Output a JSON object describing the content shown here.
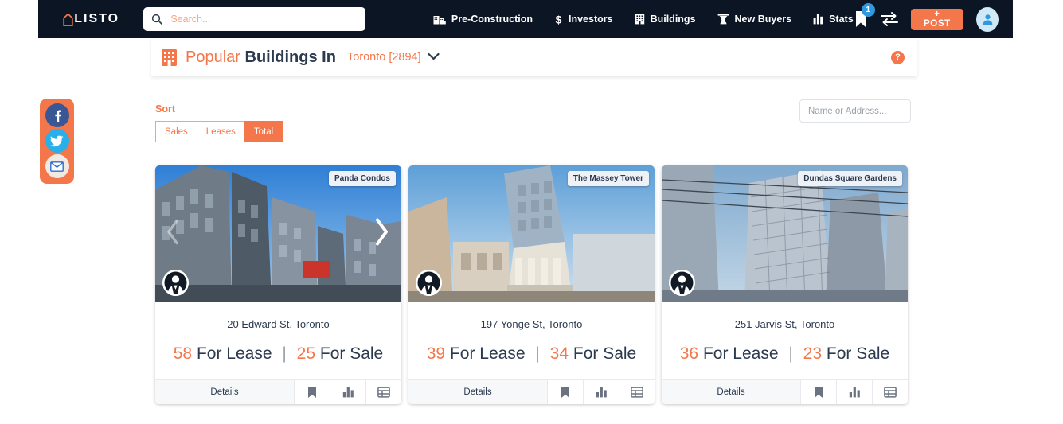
{
  "brand": {
    "name": "LISTO",
    "mark_icon": "house-outline-icon"
  },
  "search": {
    "placeholder": "Search...",
    "value": "",
    "icon": "search-icon"
  },
  "nav": {
    "items": [
      {
        "label": "Pre-Construction",
        "icon": "construction-building-icon"
      },
      {
        "label": "Investors",
        "icon": "dollar-sign-icon"
      },
      {
        "label": "Buildings",
        "icon": "building-icon"
      },
      {
        "label": "New Buyers",
        "icon": "new-buyer-icon"
      },
      {
        "label": "Stats",
        "icon": "bar-chart-icon"
      }
    ]
  },
  "header_actions": {
    "bookmark_icon": "bookmark-icon",
    "bookmark_count": "1",
    "compare_icon": "compare-arrows-icon",
    "post_label": "+ POST",
    "avatar_icon": "user-avatar-icon"
  },
  "page_title": {
    "icon": "building-icon",
    "highlight": "Popular",
    "rest": "Buildings In",
    "city": "Toronto [2894]",
    "chevron_icon": "chevron-down-icon",
    "help_label": "?"
  },
  "sort": {
    "label": "Sort",
    "options": [
      {
        "label": "Sales",
        "active": false
      },
      {
        "label": "Leases",
        "active": false
      },
      {
        "label": "Total",
        "active": true
      }
    ]
  },
  "filter_search": {
    "placeholder": "Name or Address...",
    "value": ""
  },
  "social": {
    "items": [
      {
        "name": "facebook",
        "icon": "facebook-icon"
      },
      {
        "name": "twitter",
        "icon": "twitter-icon"
      },
      {
        "name": "email",
        "icon": "envelope-icon"
      }
    ]
  },
  "cards": [
    {
      "badge": "Panda Condos",
      "address": "20 Edward St, Toronto",
      "lease_count": "58",
      "lease_label": "For Lease",
      "sale_count": "25",
      "sale_label": "For Sale",
      "separator": "|",
      "details_label": "Details",
      "agent_icon": "agent-avatar-icon",
      "next_icon": "chevron-right-icon",
      "prev_icon": "chevron-left-icon",
      "actions": [
        {
          "icon": "bookmark-icon"
        },
        {
          "icon": "bar-chart-icon"
        },
        {
          "icon": "table-grid-icon"
        }
      ]
    },
    {
      "badge": "The Massey Tower",
      "address": "197 Yonge St, Toronto",
      "lease_count": "39",
      "lease_label": "For Lease",
      "sale_count": "34",
      "sale_label": "For Sale",
      "separator": "|",
      "details_label": "Details",
      "agent_icon": "agent-avatar-icon",
      "actions": [
        {
          "icon": "bookmark-icon"
        },
        {
          "icon": "bar-chart-icon"
        },
        {
          "icon": "table-grid-icon"
        }
      ]
    },
    {
      "badge": "Dundas Square Gardens",
      "address": "251 Jarvis St, Toronto",
      "lease_count": "36",
      "lease_label": "For Lease",
      "sale_count": "23",
      "sale_label": "For Sale",
      "separator": "|",
      "details_label": "Details",
      "agent_icon": "agent-avatar-icon",
      "actions": [
        {
          "icon": "bookmark-icon"
        },
        {
          "icon": "bar-chart-icon"
        },
        {
          "icon": "table-grid-icon"
        }
      ]
    }
  ],
  "colors": {
    "accent": "#f4764b",
    "navy": "#0c1524",
    "text": "#2c3a50",
    "badge_blue": "#2f98e0"
  }
}
